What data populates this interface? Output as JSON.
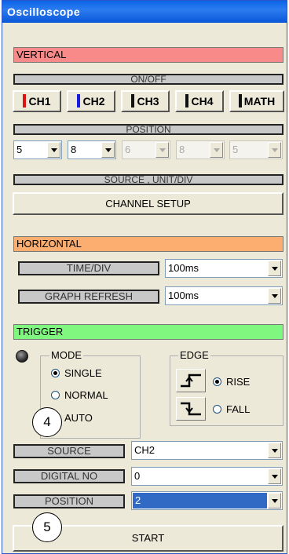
{
  "window": {
    "title": "Oscilloscope"
  },
  "vertical": {
    "section_label": "VERTICAL",
    "onoff_label": "ON/OFF",
    "channels": [
      {
        "label": "CH1",
        "color": "#e01010"
      },
      {
        "label": "CH2",
        "color": "#1a1ae0"
      },
      {
        "label": "CH3",
        "color": "#111111"
      },
      {
        "label": "CH4",
        "color": "#111111"
      },
      {
        "label": "MATH",
        "color": "#111111"
      }
    ],
    "position_label": "POSITION",
    "positions": [
      "5",
      "8",
      "6",
      "8",
      "5"
    ],
    "source_label": "SOURCE , UNIT/DIV",
    "channel_setup_label": "CHANNEL SETUP"
  },
  "horizontal": {
    "section_label": "HORIZONTAL",
    "time_div_label": "TIME/DIV",
    "time_div_value": "100ms",
    "graph_refresh_label": "GRAPH REFRESH",
    "graph_refresh_value": "100ms"
  },
  "trigger": {
    "section_label": "TRIGGER",
    "mode_label": "MODE",
    "modes": [
      "SINGLE",
      "NORMAL",
      "AUTO"
    ],
    "mode_selected": "SINGLE",
    "edge_label": "EDGE",
    "edges": [
      "RISE",
      "FALL"
    ],
    "edge_selected": "RISE",
    "source_label": "SOURCE",
    "source_value": "CH2",
    "digital_no_label": "DIGITAL NO",
    "digital_no_value": "0",
    "position_label": "POSITION",
    "position_value": "2"
  },
  "start_label": "START",
  "callouts": [
    "4",
    "5"
  ],
  "colors": {
    "vertical_bg": "#f88a8a",
    "horizontal_bg": "#fcae70",
    "trigger_bg": "#80f880",
    "selection": "#316ac5"
  }
}
